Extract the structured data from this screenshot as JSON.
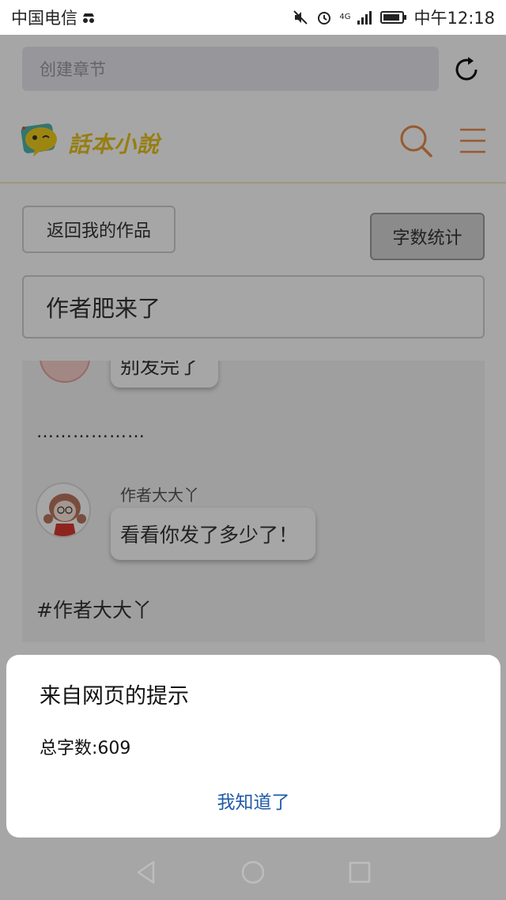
{
  "statusbar": {
    "carrier": "中国电信",
    "network": "4G",
    "time": "中午12:18"
  },
  "browser": {
    "url_placeholder": "创建章节"
  },
  "site": {
    "logo_text": "話本小說"
  },
  "page": {
    "back_button": "返回我的作品",
    "word_count_button": "字数统计",
    "chapter_title": "作者肥来了"
  },
  "editor": {
    "previous_bubble_text": "别发完了",
    "ellipsis": "………………",
    "speaker_name": "作者大大丫",
    "bubble_text": "看看你发了多少了！",
    "hashtag": "#作者大大丫"
  },
  "dialog": {
    "title": "来自网页的提示",
    "message": "总字数:609",
    "ok_button": "我知道了"
  },
  "colors": {
    "accent_orange": "#e88a4a",
    "logo_yellow": "#e7c21a",
    "dialog_button_blue": "#1f5aa8"
  }
}
